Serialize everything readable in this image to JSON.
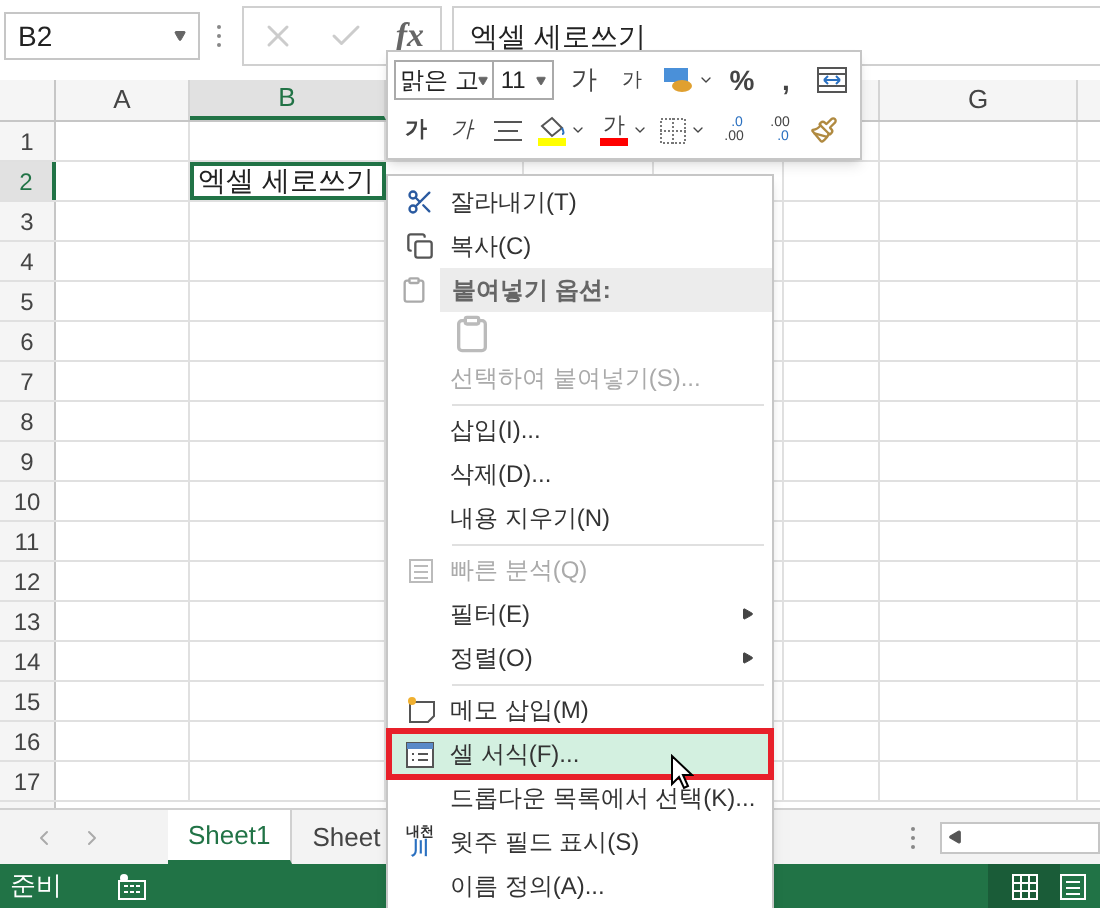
{
  "formula_bar": {
    "name_box": "B2",
    "fx": "fx",
    "formula": "엑셀 세로쓰기"
  },
  "sheet": {
    "columns": [
      {
        "label": "A",
        "selected": false
      },
      {
        "label": "B",
        "selected": true
      },
      {
        "label": "G",
        "selected": false
      }
    ],
    "rows": [
      {
        "label": "1",
        "selected": false
      },
      {
        "label": "2",
        "selected": true,
        "text": "엑셀 세로쓰기"
      },
      {
        "label": "3",
        "selected": false
      },
      {
        "label": "4",
        "selected": false
      },
      {
        "label": "5",
        "selected": false
      },
      {
        "label": "6",
        "selected": false
      },
      {
        "label": "7",
        "selected": false
      },
      {
        "label": "8",
        "selected": false
      },
      {
        "label": "9",
        "selected": false
      },
      {
        "label": "10",
        "selected": false
      },
      {
        "label": "11",
        "selected": false
      },
      {
        "label": "12",
        "selected": false
      },
      {
        "label": "13",
        "selected": false
      },
      {
        "label": "14",
        "selected": false
      },
      {
        "label": "15",
        "selected": false
      },
      {
        "label": "16",
        "selected": false
      },
      {
        "label": "17",
        "selected": false
      }
    ]
  },
  "mini_toolbar": {
    "font_name": "맑은 고",
    "font_size": "11",
    "row1": [
      {
        "kind": "grow",
        "label": "가"
      },
      {
        "kind": "shrink",
        "label": "가"
      },
      {
        "kind": "accounting"
      },
      {
        "kind": "percent",
        "label": "%"
      },
      {
        "kind": "comma",
        "label": ","
      },
      {
        "kind": "merge"
      }
    ],
    "row2": [
      {
        "kind": "bold",
        "label": "가"
      },
      {
        "kind": "italic",
        "label": "가"
      },
      {
        "kind": "align"
      },
      {
        "kind": "fill",
        "color": "#ffff00"
      },
      {
        "kind": "font_color",
        "label": "가",
        "color": "#ff0000"
      },
      {
        "kind": "borders"
      },
      {
        "kind": "increase_decimal",
        "labels": [
          ".0",
          ".00"
        ]
      },
      {
        "kind": "decrease_decimal",
        "labels": [
          ".00",
          ".0"
        ]
      },
      {
        "kind": "painter"
      }
    ]
  },
  "context_menu": [
    {
      "kind": "cut",
      "label": "잘라내기(T)",
      "disabled": false,
      "selected": false,
      "marked": false
    },
    {
      "kind": "copy",
      "label": "복사(C)",
      "disabled": false,
      "selected": false,
      "marked": false
    },
    {
      "kind": "header",
      "label": "붙여넣기 옵션:"
    },
    {
      "kind": "paste_icons"
    },
    {
      "kind": "plain",
      "label": "선택하여 붙여넣기(S)...",
      "disabled": true,
      "selected": false,
      "marked": false
    },
    {
      "kind": "separator"
    },
    {
      "kind": "plain",
      "label": "삽입(I)...",
      "disabled": false,
      "selected": false,
      "marked": false
    },
    {
      "kind": "plain",
      "label": "삭제(D)...",
      "disabled": false,
      "selected": false,
      "marked": false
    },
    {
      "kind": "plain",
      "label": "내용 지우기(N)",
      "disabled": false,
      "selected": false,
      "marked": false
    },
    {
      "kind": "separator"
    },
    {
      "kind": "quick_analysis",
      "label": "빠른 분석(Q)",
      "disabled": true,
      "selected": false,
      "marked": false
    },
    {
      "kind": "submenu",
      "label": "필터(E)",
      "disabled": false,
      "selected": false,
      "marked": false
    },
    {
      "kind": "submenu",
      "label": "정렬(O)",
      "disabled": false,
      "selected": false,
      "marked": false
    },
    {
      "kind": "separator"
    },
    {
      "kind": "comment",
      "label": "메모 삽입(M)",
      "disabled": false,
      "selected": false,
      "marked": false
    },
    {
      "kind": "format",
      "label": "셀 서식(F)...",
      "disabled": false,
      "selected": true,
      "marked": true
    },
    {
      "kind": "plain",
      "label": "드롭다운 목록에서 선택(K)...",
      "disabled": false,
      "selected": false,
      "marked": false
    },
    {
      "kind": "phonetic",
      "label": "윗주 필드 표시(S)",
      "icon_text": [
        "내천",
        "川"
      ],
      "disabled": false,
      "selected": false,
      "marked": false
    },
    {
      "kind": "plain",
      "label": "이름 정의(A)...",
      "disabled": false,
      "selected": false,
      "marked": false
    }
  ],
  "sheet_tabs": [
    {
      "label": "Sheet1",
      "selected": true
    },
    {
      "label": "Sheet",
      "selected": false
    }
  ],
  "status_bar": {
    "text": "준비"
  }
}
